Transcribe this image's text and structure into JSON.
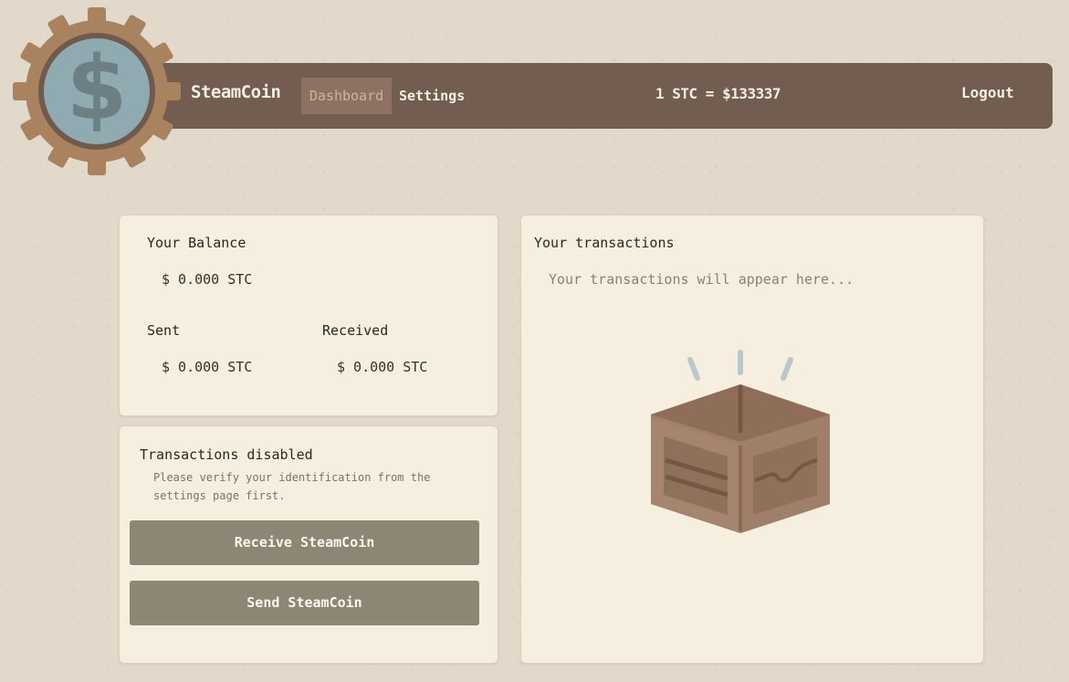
{
  "app": {
    "brand": "SteamCoin"
  },
  "nav": {
    "tabs": [
      {
        "label": "Dashboard",
        "active": true
      },
      {
        "label": "Settings",
        "active": false
      }
    ],
    "rate": "1 STC = $133337",
    "logout": "Logout"
  },
  "balance": {
    "title": "Your Balance",
    "value": "$ 0.000 STC",
    "sent_label": "Sent",
    "sent_value": "$ 0.000 STC",
    "received_label": "Received",
    "received_value": "$ 0.000 STC"
  },
  "actions": {
    "title": "Transactions disabled",
    "hint": "Please verify your identification from the settings page first.",
    "receive_label": "Receive SteamCoin",
    "send_label": "Send SteamCoin"
  },
  "transactions": {
    "title": "Your transactions",
    "empty_text": "Your transactions will appear here..."
  },
  "colors": {
    "navbar": "#735d50",
    "button": "#8c8774",
    "card": "#f6eedf",
    "gear": "#a9825f",
    "coin": "#8faab0"
  },
  "icons": {
    "logo": "gear-coin-logo-icon",
    "empty_state": "open-box-icon"
  }
}
